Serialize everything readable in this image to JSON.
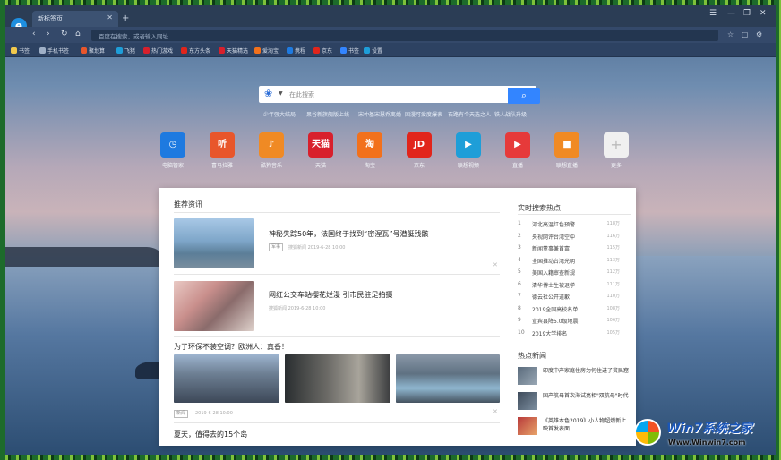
{
  "browser": {
    "tab_title": "新标签页",
    "address_placeholder": "百度在搜索，或者输入网址",
    "bookmarks": [
      "书签",
      "手机书签",
      "聚划算",
      "飞猪",
      "热门游戏",
      "东方头条",
      "天猫精选",
      "爱淘宝",
      "携程",
      "京东",
      "书签",
      "设置"
    ]
  },
  "search": {
    "placeholder": "在此搜索",
    "hotwords": [
      "少年强大结局",
      "果谷新旗舰版上线",
      "宋仲基宋慧乔离婚",
      "国漫可爱度爆表",
      "石路有个天选之人",
      "铁人战队升级"
    ]
  },
  "apps": [
    {
      "label": "电脑管家",
      "icon": "clock-icon",
      "color": "#1e7ae0",
      "glyph": "◷"
    },
    {
      "label": "喜马拉雅",
      "icon": "himalaya-icon",
      "color": "#e8562b",
      "glyph": "听"
    },
    {
      "label": "酷狗音乐",
      "icon": "music-icon",
      "color": "#f08a24",
      "glyph": "♪"
    },
    {
      "label": "天猫",
      "icon": "tmall-icon",
      "color": "#d8202c",
      "glyph": "天猫"
    },
    {
      "label": "淘宝",
      "icon": "taobao-icon",
      "color": "#f2711c",
      "glyph": "淘"
    },
    {
      "label": "京东",
      "icon": "jd-icon",
      "color": "#e1251b",
      "glyph": "JD"
    },
    {
      "label": "联想视频",
      "icon": "video-play-icon",
      "color": "#1e9ed8",
      "glyph": "▶"
    },
    {
      "label": "直播",
      "icon": "live-camera-icon",
      "color": "#e63a3a",
      "glyph": "▶"
    },
    {
      "label": "联想直播",
      "icon": "tv-icon",
      "color": "#f08a24",
      "glyph": "■"
    },
    {
      "label": "更多",
      "icon": "plus-icon",
      "color": "#f0f0f0",
      "glyph": "+"
    }
  ],
  "feed": {
    "section_title": "推荐资讯",
    "articles": [
      {
        "title": "神秘失踪50年，法国终于找到“密涅瓦”号潜艇残骸",
        "tag": "军事",
        "meta": "搜狐新闻  2019-6-28 10:00"
      },
      {
        "title": "网红公交车站樱花烂漫 引市民驻足拍摄",
        "tag": "",
        "meta": "搜狐新闻  2019-6-28 10:00"
      }
    ],
    "gallery_title": "为了环保不装空调？欧洲人：真香！",
    "gallery_tag": "新闻",
    "gallery_meta": "2019-6-28 10:00",
    "next_title": "夏天，值得去的15个岛"
  },
  "sidebar": {
    "ranking_title": "实时搜索热点",
    "ranking": [
      {
        "n": "1",
        "t": "河北高温红色预警",
        "c": "118万"
      },
      {
        "n": "2",
        "t": "央视网评台湾空中",
        "c": "116万"
      },
      {
        "n": "3",
        "t": "新闻董事兼首富",
        "c": "115万"
      },
      {
        "n": "4",
        "t": "全国推动台湾光明",
        "c": "113万"
      },
      {
        "n": "5",
        "t": "美国入籍审查新规",
        "c": "112万"
      },
      {
        "n": "6",
        "t": "清华博士生被退学",
        "c": "111万"
      },
      {
        "n": "7",
        "t": "德云社公开道歉",
        "c": "110万"
      },
      {
        "n": "8",
        "t": "2019全国高校名单",
        "c": "108万"
      },
      {
        "n": "9",
        "t": "宣宾县降5.0级地震",
        "c": "106万"
      },
      {
        "n": "10",
        "t": "2019大学排名",
        "c": "105万"
      }
    ],
    "hot_title": "热点新闻",
    "hot": [
      {
        "t": "印度中产家庭住房为何住进了贫民窟"
      },
      {
        "t": "国产航母首次海试亮相\"双航母\"时代"
      },
      {
        "t": "《英雄本色2019》小人物超燃新上映首发表面"
      }
    ]
  },
  "watermark": {
    "brand": "Win7系统之家",
    "url": "Www.Winwin7.com"
  },
  "colors": {
    "accent": "#3385ff",
    "frame": "#2e8a3a"
  }
}
